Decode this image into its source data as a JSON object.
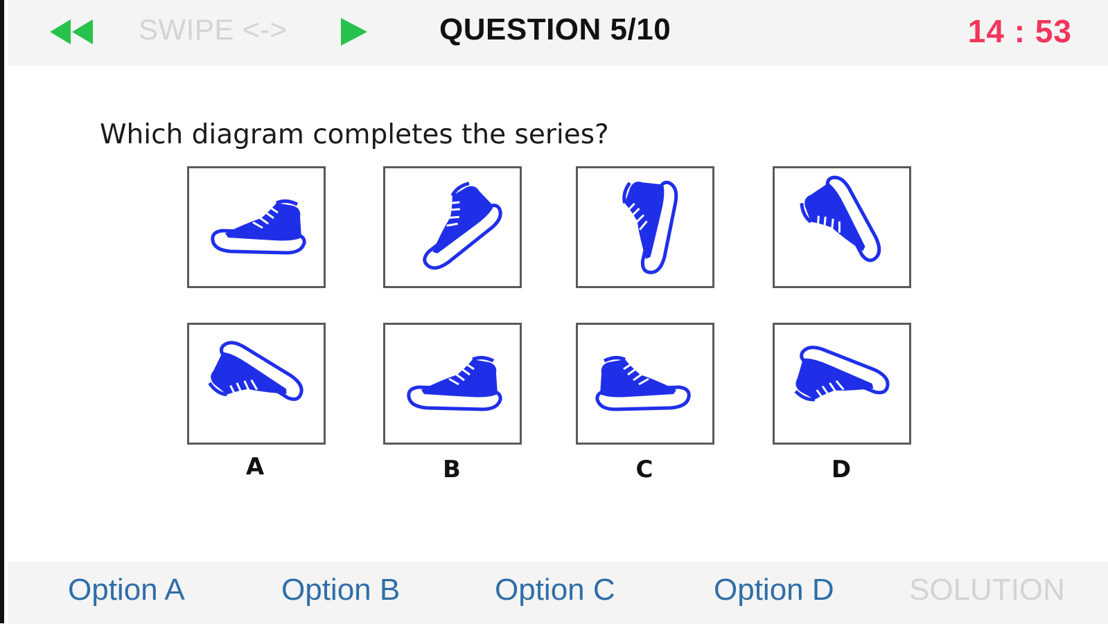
{
  "header": {
    "swipe_label": "SWIPE <->",
    "question_counter": "QUESTION 5/10",
    "timer": "14 : 53",
    "icons": {
      "back": "rewind-icon",
      "next": "play-icon"
    },
    "colors": {
      "nav_green": "#27c24c",
      "timer_red": "#f2355b"
    }
  },
  "question": {
    "prompt": "Which diagram completes the series?"
  },
  "series_panels": [
    {
      "icon": "sneaker-icon",
      "rotation_deg": 0
    },
    {
      "icon": "sneaker-icon",
      "rotation_deg": -40
    },
    {
      "icon": "sneaker-icon",
      "rotation_deg": -80
    },
    {
      "icon": "sneaker-icon",
      "rotation_deg": -120
    }
  ],
  "answer_panels": [
    {
      "letter": "A",
      "icon": "sneaker-icon",
      "rotation_deg": -150
    },
    {
      "letter": "B",
      "icon": "sneaker-icon",
      "rotation_deg": 0
    },
    {
      "letter": "C",
      "icon": "sneaker-icon",
      "rotation_deg": 0,
      "mirrored": true
    },
    {
      "letter": "D",
      "icon": "sneaker-icon",
      "rotation_deg": -160
    }
  ],
  "footer": {
    "options": [
      "Option A",
      "Option B",
      "Option C",
      "Option D"
    ],
    "solution_label": "SOLUTION",
    "colors": {
      "option_blue": "#2e6ea7",
      "disabled_gray": "#d3d3d3"
    }
  },
  "shoe_color": "#1f2fe8"
}
